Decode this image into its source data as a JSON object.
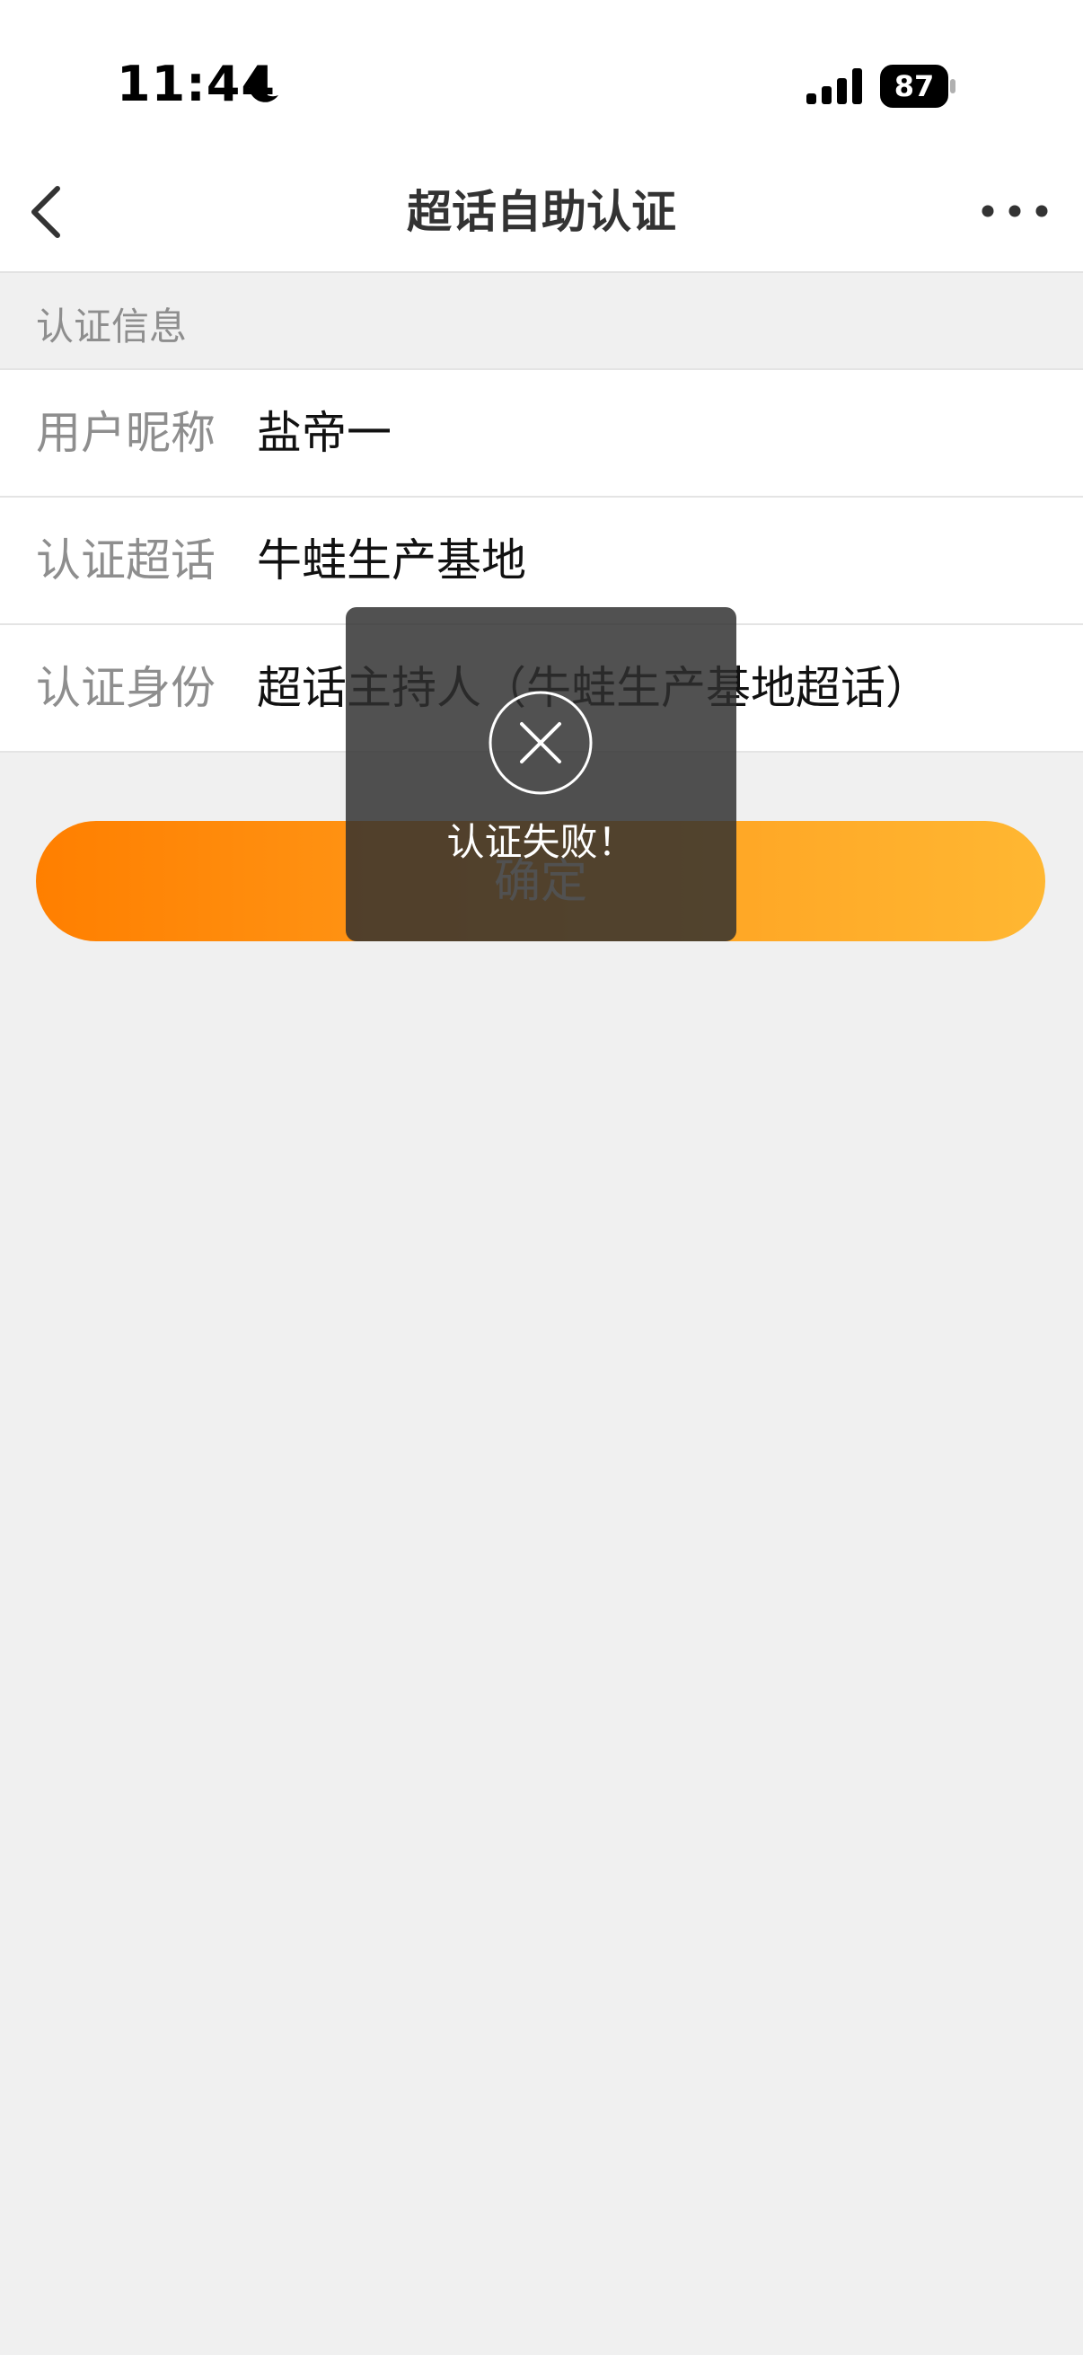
{
  "status_bar": {
    "time": "11:44",
    "battery": "87",
    "icons": [
      "moon-icon",
      "signal-icon",
      "battery-icon"
    ]
  },
  "nav": {
    "title": "超话自助认证",
    "icons": [
      "back-icon",
      "more-icon"
    ]
  },
  "section": {
    "label": "认证信息"
  },
  "info": [
    {
      "label": "用户昵称",
      "value": "盐帝一"
    },
    {
      "label": "认证超话",
      "value": "牛蛙生产基地"
    },
    {
      "label": "认证身份",
      "value": "超话主持人（牛蛙生产基地超话）"
    }
  ],
  "confirm_button": {
    "label": "确定"
  },
  "toast": {
    "message": "认证失败！",
    "icon": "close-circle-icon"
  },
  "colors": {
    "accent_start": "#ff7f00",
    "accent_end": "#ffb732",
    "background": "#f0f0f0",
    "toast_bg": "#303030"
  }
}
